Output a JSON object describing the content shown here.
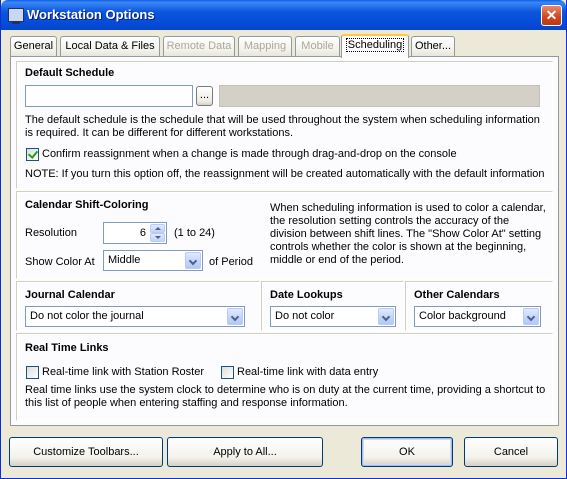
{
  "window": {
    "title": "Workstation Options",
    "close_glyph": "✕"
  },
  "tabs": [
    {
      "label": "General",
      "state": "normal"
    },
    {
      "label": "Local Data & Files",
      "state": "normal"
    },
    {
      "label": "Remote Data",
      "state": "disabled"
    },
    {
      "label": "Mapping",
      "state": "disabled"
    },
    {
      "label": "Mobile",
      "state": "disabled"
    },
    {
      "label": "Scheduling",
      "state": "active"
    },
    {
      "label": "Other...",
      "state": "normal"
    }
  ],
  "default_schedule": {
    "title": "Default Schedule",
    "value": "",
    "browse_label": "...",
    "display_value": "",
    "description": "The default schedule is the schedule that will be used throughout the system when scheduling information is required.  It can be different for different workstations.",
    "confirm_label": "Confirm reassignment when a change is made through drag-and-drop on the console",
    "confirm_checked": true,
    "note": "NOTE: If you turn this option off, the reassignment will be created automatically with the default information"
  },
  "shift_coloring": {
    "title": "Calendar Shift-Coloring",
    "resolution_label": "Resolution",
    "resolution_value": "6",
    "resolution_range": "(1 to 24)",
    "show_color_label": "Show Color At",
    "show_color_value": "Middle",
    "of_period_label": "of Period",
    "description": "When scheduling information is used to color a calendar, the resolution setting controls the accuracy of the division between shift lines. The \"Show Color At\" setting controls whether the color is shown at the beginning, middle or end of the period."
  },
  "journal_calendar": {
    "title": "Journal Calendar",
    "value": "Do not color the journal"
  },
  "date_lookups": {
    "title": "Date Lookups",
    "value": "Do not color"
  },
  "other_calendars": {
    "title": "Other Calendars",
    "value": "Color background"
  },
  "real_time_links": {
    "title": "Real Time Links",
    "station_roster_label": "Real-time link with Station Roster",
    "station_roster_checked": false,
    "data_entry_label": "Real-time link with data entry",
    "data_entry_checked": false,
    "description": "Real time links use the system clock to determine who is on duty at the current time, providing a shortcut to this list of people when entering staffing and response information."
  },
  "buttons": {
    "customize_toolbars": "Customize Toolbars...",
    "apply_to_all": "Apply to All...",
    "ok": "OK",
    "cancel": "Cancel"
  },
  "colors": {
    "titlebar": "#0A56DD",
    "window_bg": "#ECE9D8",
    "tab_highlight": "#FFC83C",
    "close_button": "#D0431E"
  },
  "icons": {
    "title_icon": "computer-icon",
    "close": "close-icon",
    "dropdown": "chevron-down-icon"
  }
}
